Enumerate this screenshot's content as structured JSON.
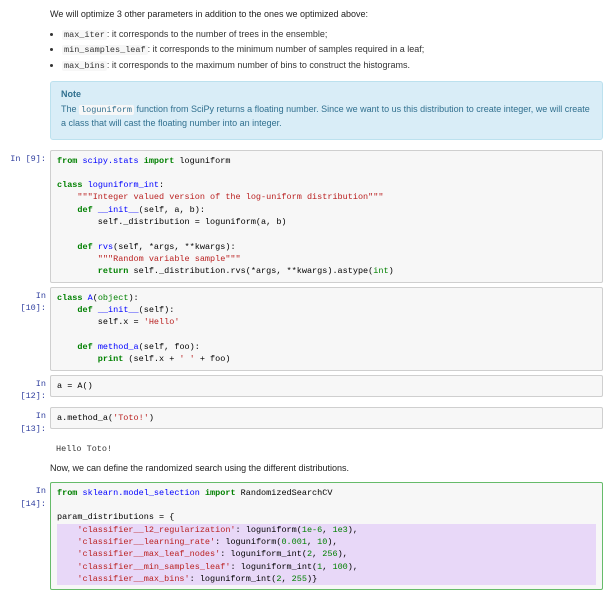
{
  "intro": "We will optimize 3 other parameters in addition to the ones we optimized above:",
  "params": [
    {
      "code": "max_iter",
      "text": ": it corresponds to the number of trees in the ensemble;"
    },
    {
      "code": "min_samples_leaf",
      "text": ": it corresponds to the minimum number of samples required in a leaf;"
    },
    {
      "code": "max_bins",
      "text": ": it corresponds to the maximum number of bins to construct the histograms."
    }
  ],
  "note": {
    "title": "Note",
    "body_pre": "The ",
    "body_code": "loguniform",
    "body_post": " function from SciPy returns a floating number. Since we want to us this distribution to create integer, we will create a class that will cast the floating number into an integer."
  },
  "cells": {
    "c9": {
      "prompt": "In [9]:"
    },
    "c10": {
      "prompt": "In [10]:"
    },
    "c12": {
      "prompt": "In [12]:"
    },
    "c13": {
      "prompt": "In [13]:"
    },
    "c14": {
      "prompt": "In [14]:"
    },
    "out13": {
      "text": "Hello Toto!"
    }
  },
  "code9": {
    "l1_a": "from",
    "l1_b": " scipy.stats ",
    "l1_c": "import",
    "l1_d": " loguniform",
    "l3_a": "class",
    "l3_b": " loguniform_int",
    "l3_c": ":",
    "l4": "    \"\"\"Integer valued version of the log-uniform distribution\"\"\"",
    "l5_a": "    def",
    "l5_b": " __init__",
    "l5_c": "(self, a, b):",
    "l6": "        self._distribution = loguniform(a, b)",
    "l8_a": "    def",
    "l8_b": " rvs",
    "l8_c": "(self, *args, **kwargs):",
    "l9": "        \"\"\"Random variable sample\"\"\"",
    "l10_a": "        return",
    "l10_b": " self._distribution.rvs(*args, **kwargs).astype(",
    "l10_c": "int",
    "l10_d": ")"
  },
  "code10": {
    "l1_a": "class",
    "l1_b": " A",
    "l1_c": "(",
    "l1_d": "object",
    "l1_e": "):",
    "l2_a": "    def",
    "l2_b": " __init__",
    "l2_c": "(self):",
    "l3_a": "        self.x = ",
    "l3_b": "'Hello'",
    "l5_a": "    def",
    "l5_b": " method_a",
    "l5_c": "(self, foo):",
    "l6_a": "        print",
    "l6_b": " (self.x + ",
    "l6_c": "' '",
    "l6_d": " + foo)"
  },
  "code12": {
    "l1": "a = A()"
  },
  "code13": {
    "l1_a": "a.method_a(",
    "l1_b": "'Toto!'",
    "l1_c": ")"
  },
  "outro": "Now, we can define the randomized search using the different distributions.",
  "code14": {
    "l1_a": "from",
    "l1_b": " sklearn.model_selection ",
    "l1_c": "import",
    "l1_d": " RandomizedSearchCV",
    "l3": "param_distributions = {",
    "l4_a": "    ",
    "l4_b": "'classifier__l2_regularization'",
    "l4_c": ": loguniform(",
    "l4_d": "1e-6",
    "l4_e": ", ",
    "l4_f": "1e3",
    "l4_g": "),",
    "l5_a": "    ",
    "l5_b": "'classifier__learning_rate'",
    "l5_c": ": loguniform(",
    "l5_d": "0.001",
    "l5_e": ", ",
    "l5_f": "10",
    "l5_g": "),",
    "l6_a": "    ",
    "l6_b": "'classifier__max_leaf_nodes'",
    "l6_c": ": loguniform_int(",
    "l6_d": "2",
    "l6_e": ", ",
    "l6_f": "256",
    "l6_g": "),",
    "l7_a": "    ",
    "l7_b": "'classifier__min_samples_leaf'",
    "l7_c": ": loguniform_int(",
    "l7_d": "1",
    "l7_e": ", ",
    "l7_f": "100",
    "l7_g": "),",
    "l8_a": "    ",
    "l8_b": "'classifier__max_bins'",
    "l8_c": ": loguniform_int(",
    "l8_d": "2",
    "l8_e": ", ",
    "l8_f": "255",
    "l8_g": ")}"
  }
}
